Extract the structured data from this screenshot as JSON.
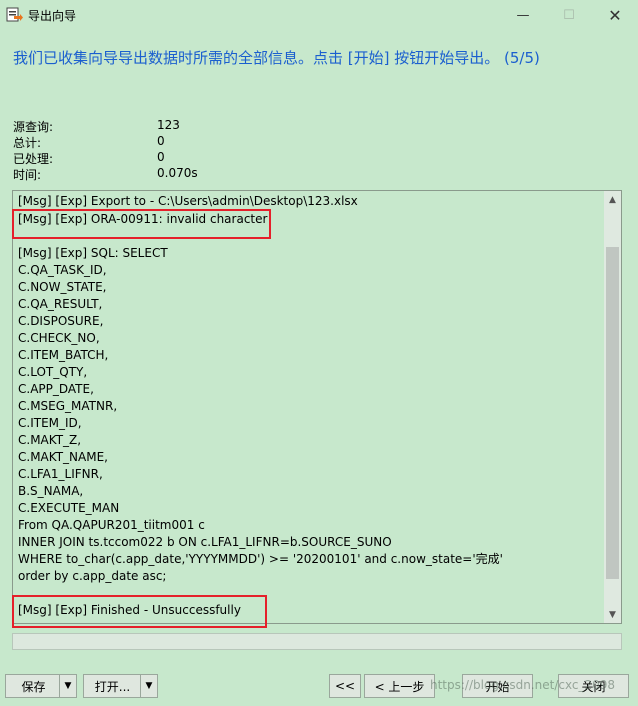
{
  "window": {
    "title": "导出向导",
    "min_glyph": "—",
    "max_glyph": "☐",
    "close_glyph": "✕",
    "icon": "export-wizard-icon"
  },
  "header": {
    "text": "我们已收集向导导出数据时所需的全部信息。点击 [开始] 按钮开始导出。 (5/5)"
  },
  "info": [
    {
      "label": "源查询:",
      "value": "123"
    },
    {
      "label": "总计:",
      "value": "0"
    },
    {
      "label": "已处理:",
      "value": "0"
    },
    {
      "label": "时间:",
      "value": "0.070s"
    }
  ],
  "log": {
    "lines": [
      "[Msg] [Exp] Export to - C:\\Users\\admin\\Desktop\\123.xlsx",
      "[Msg] [Exp] ORA-00911: invalid character",
      "",
      "[Msg] [Exp] SQL: SELECT",
      "C.QA_TASK_ID,",
      "C.NOW_STATE,",
      "C.QA_RESULT,",
      "C.DISPOSURE,",
      "C.CHECK_NO,",
      "C.ITEM_BATCH,",
      "C.LOT_QTY,",
      "C.APP_DATE,",
      "C.MSEG_MATNR,",
      "C.ITEM_ID,",
      "C.MAKT_Z,",
      "C.MAKT_NAME,",
      "C.LFA1_LIFNR,",
      "B.S_NAMA,",
      "C.EXECUTE_MAN",
      "From QA.QAPUR201_tiitm001 c",
      "INNER JOIN ts.tccom022 b ON c.LFA1_LIFNR=b.SOURCE_SUNO",
      "WHERE to_char(c.app_date,'YYYYMMDD')  >= '20200101' and c.now_state='完成'",
      "order by c.app_date asc;",
      "",
      "[Msg] [Exp] Finished - Unsuccessfully"
    ],
    "scroll_up": "▲",
    "scroll_down": "▼"
  },
  "progress": {
    "fraction": 0
  },
  "buttons": {
    "save": "保存",
    "open": "打开...",
    "first": "<<",
    "back": "< 上一步",
    "start": "开始",
    "close": "关闭",
    "dropdown_glyph": "▼"
  },
  "watermark": "https://blog.csdn.net/cxc_2098",
  "colors": {
    "background": "#c7e8cc",
    "header_text": "#1b5fcf",
    "highlight": "#e5202a"
  }
}
